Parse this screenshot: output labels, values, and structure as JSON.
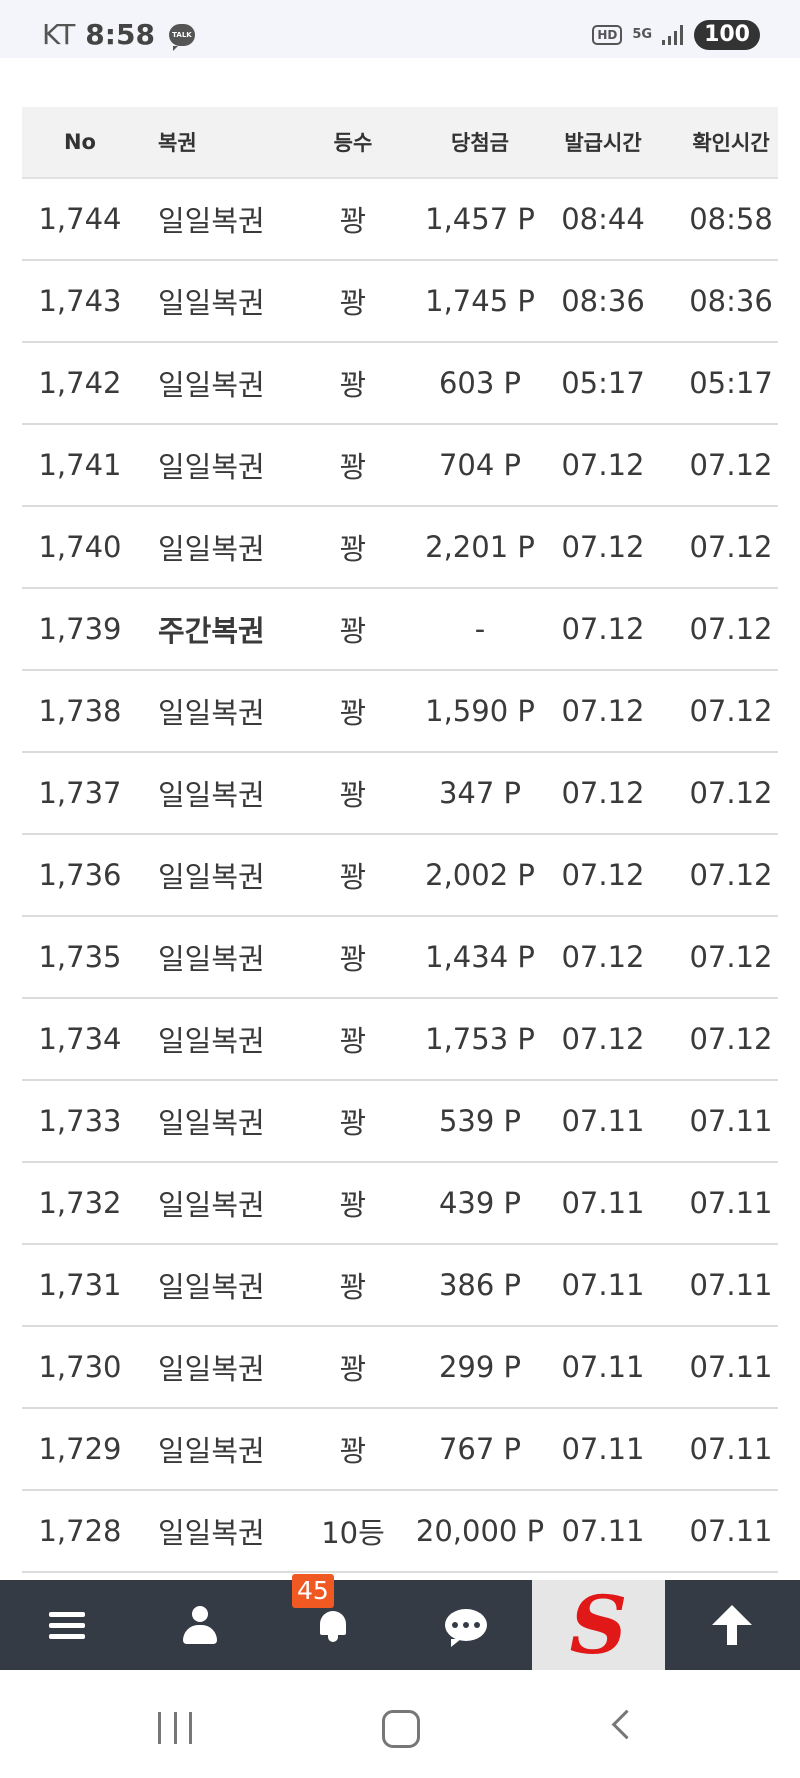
{
  "status_bar": {
    "carrier": "KT",
    "time": "8:58",
    "talk_label": "TALK",
    "hd_label": "HD",
    "network_label": "5G",
    "battery": "100"
  },
  "table": {
    "headers": {
      "no": "No",
      "kind": "복권",
      "rank": "등수",
      "prize": "당첨금",
      "issued": "발급시간",
      "checked": "확인시간"
    },
    "rows": [
      {
        "no": "1,744",
        "kind": "일일복권",
        "rank": "꽝",
        "prize": "1,457 P",
        "issued": "08:44",
        "checked": "08:58"
      },
      {
        "no": "1,743",
        "kind": "일일복권",
        "rank": "꽝",
        "prize": "1,745 P",
        "issued": "08:36",
        "checked": "08:36"
      },
      {
        "no": "1,742",
        "kind": "일일복권",
        "rank": "꽝",
        "prize": "603 P",
        "issued": "05:17",
        "checked": "05:17"
      },
      {
        "no": "1,741",
        "kind": "일일복권",
        "rank": "꽝",
        "prize": "704 P",
        "issued": "07.12",
        "checked": "07.12"
      },
      {
        "no": "1,740",
        "kind": "일일복권",
        "rank": "꽝",
        "prize": "2,201 P",
        "issued": "07.12",
        "checked": "07.12"
      },
      {
        "no": "1,739",
        "kind": "주간복권",
        "rank": "꽝",
        "prize": "-",
        "issued": "07.12",
        "checked": "07.12"
      },
      {
        "no": "1,738",
        "kind": "일일복권",
        "rank": "꽝",
        "prize": "1,590 P",
        "issued": "07.12",
        "checked": "07.12"
      },
      {
        "no": "1,737",
        "kind": "일일복권",
        "rank": "꽝",
        "prize": "347 P",
        "issued": "07.12",
        "checked": "07.12"
      },
      {
        "no": "1,736",
        "kind": "일일복권",
        "rank": "꽝",
        "prize": "2,002 P",
        "issued": "07.12",
        "checked": "07.12"
      },
      {
        "no": "1,735",
        "kind": "일일복권",
        "rank": "꽝",
        "prize": "1,434 P",
        "issued": "07.12",
        "checked": "07.12"
      },
      {
        "no": "1,734",
        "kind": "일일복권",
        "rank": "꽝",
        "prize": "1,753 P",
        "issued": "07.12",
        "checked": "07.12"
      },
      {
        "no": "1,733",
        "kind": "일일복권",
        "rank": "꽝",
        "prize": "539 P",
        "issued": "07.11",
        "checked": "07.11"
      },
      {
        "no": "1,732",
        "kind": "일일복권",
        "rank": "꽝",
        "prize": "439 P",
        "issued": "07.11",
        "checked": "07.11"
      },
      {
        "no": "1,731",
        "kind": "일일복권",
        "rank": "꽝",
        "prize": "386 P",
        "issued": "07.11",
        "checked": "07.11"
      },
      {
        "no": "1,730",
        "kind": "일일복권",
        "rank": "꽝",
        "prize": "299 P",
        "issued": "07.11",
        "checked": "07.11"
      },
      {
        "no": "1,729",
        "kind": "일일복권",
        "rank": "꽝",
        "prize": "767 P",
        "issued": "07.11",
        "checked": "07.11"
      },
      {
        "no": "1,728",
        "kind": "일일복권",
        "rank": "10등",
        "prize": "20,000 P",
        "issued": "07.11",
        "checked": "07.11"
      }
    ]
  },
  "bottom_nav": {
    "items": [
      "menu-icon",
      "user-icon",
      "bell-icon",
      "chat-icon",
      "site-logo",
      "scroll-top-icon"
    ],
    "notification_count": "45",
    "logo_letter": "S",
    "logo_color": "#e01818",
    "bar_color": "#343b45",
    "badge_color": "#f05a22"
  },
  "system_nav": {
    "items": [
      "recent-apps-icon",
      "home-icon",
      "back-icon"
    ]
  }
}
